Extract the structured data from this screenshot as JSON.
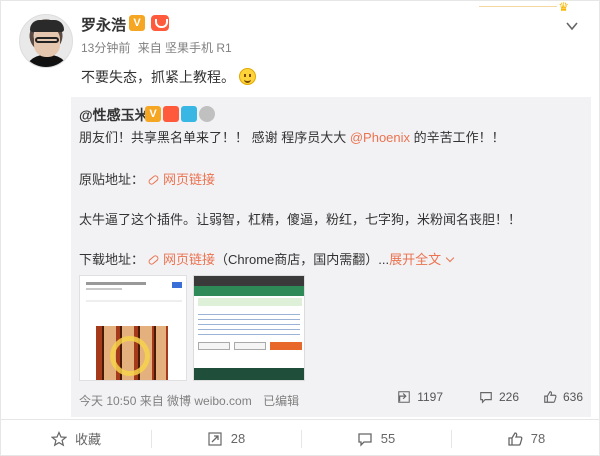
{
  "post": {
    "author": "罗永浩",
    "time": "13分钟前",
    "source": "来自 坚果手机 R1",
    "text": "不要失态，抓紧上教程。"
  },
  "repost": {
    "author": "@性感玉米",
    "line1_pre": "朋友们！共享黑名单来了！！ 感谢 程序员大大 ",
    "line1_at": "@Phoenix",
    "line1_post": " 的辛苦工作！！",
    "line2_label": "原贴地址：",
    "line2_link": "网页链接",
    "line3": "太牛逼了这个插件。让弱智，杠精，傻逼，粉红，七字狗，米粉闻名丧胆！！",
    "line4_label": "下载地址：",
    "line4_link": "网页链接",
    "line4_post": "（Chrome商店，国内需翻）...",
    "expand": "展开全文",
    "footer_source": "今天 10:50 来自 微博 weibo.com",
    "edit": "已编辑",
    "forwards": "1197",
    "comments": "226",
    "likes": "636"
  },
  "actions": {
    "favorite": "收藏",
    "forward": "28",
    "comment": "55",
    "like": "78"
  },
  "colors": {
    "accent": "#eb7350",
    "repost_bg": "#f2f2f5"
  }
}
